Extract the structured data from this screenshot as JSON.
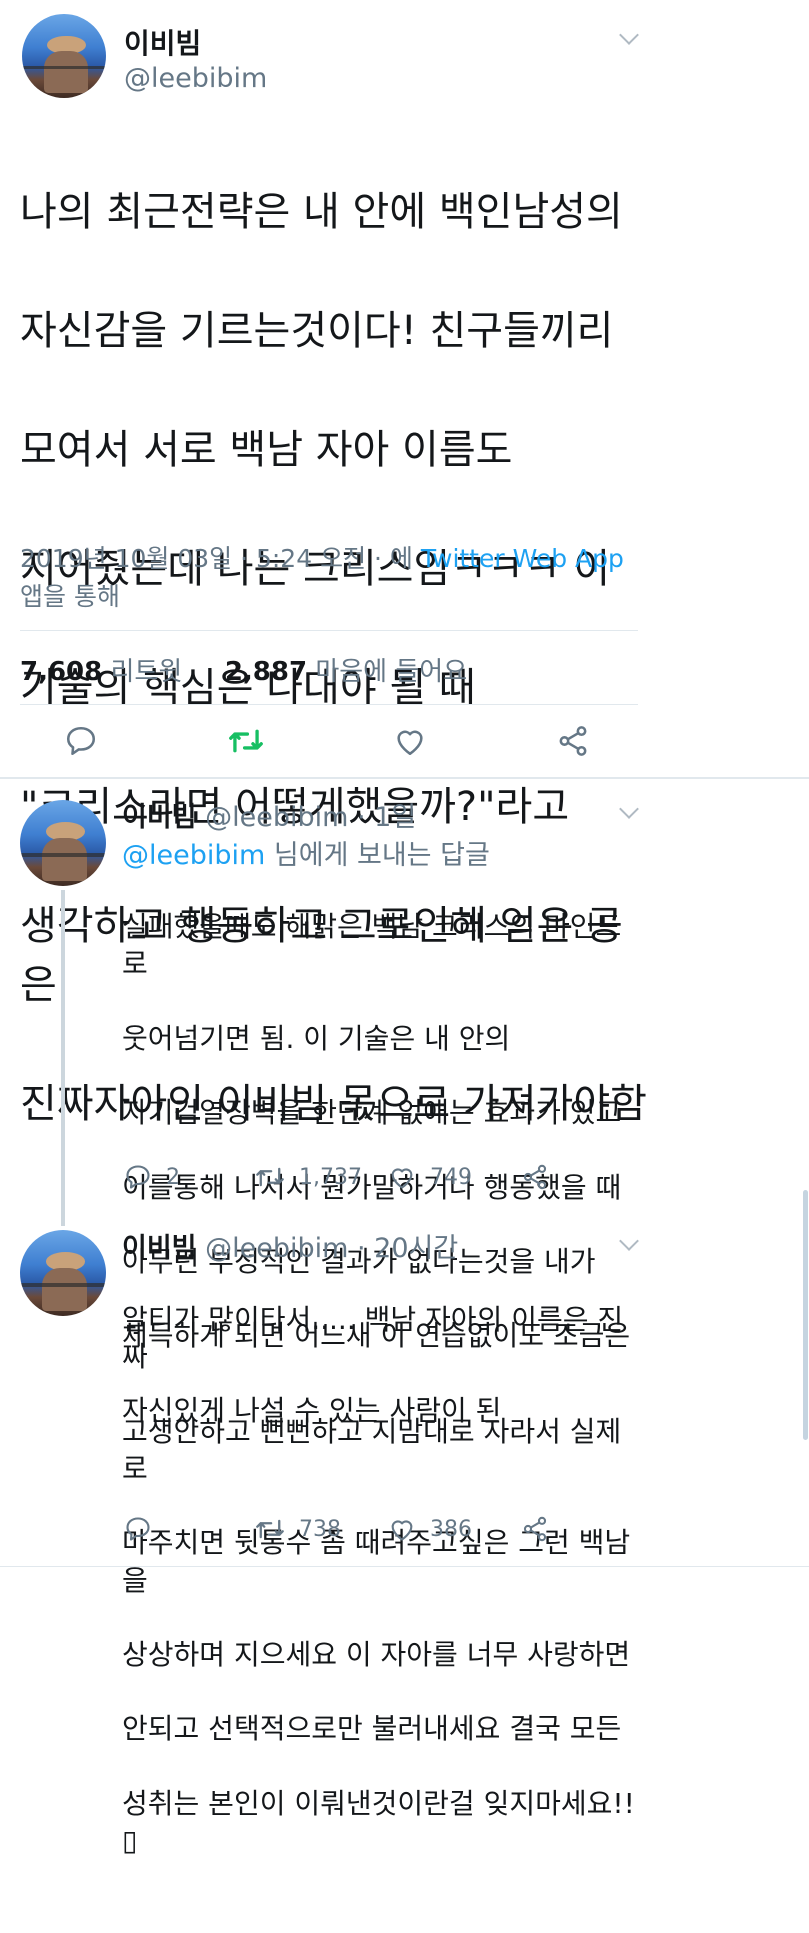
{
  "main_tweet": {
    "display_name": "이비빔",
    "handle": "@leebibim",
    "text_lines": [
      "나의 최근전략은 내 안에 백인남성의",
      "자신감을 기르는것이다! 친구들끼리",
      "모여서 서로 백남 자아 이름도",
      "지어줬는데 나는 크리스임ㅋㅋㅋ 이",
      "기술의 핵심은 나대야 될 때",
      "\"크리스라면 어떻게했을까?\"라고",
      "생각하고 행동하고 그로인해 얻은 공은",
      "진짜자아인 이비빔 몫으로 가져가야함"
    ],
    "timestamp_prefix": "2019년 10월 03일 · 5:24 오전 · 에 ",
    "source_app": "Twitter Web App",
    "timestamp_suffix": "앱을 통해",
    "retweet_count": "7,608",
    "retweet_label": "리트윗",
    "like_count": "2,887",
    "like_label": "마음에 들어요"
  },
  "replies": [
    {
      "display_name": "이비빔",
      "handle_time": "@leebibim · 1일",
      "reply_to_handle": "@leebibim",
      "reply_to_label": " 님에게 보내는 답글",
      "text_lines": [
        "실패했을때도 해맑은 백남 크리스의 마인드로",
        "웃어넘기면 됨. 이 기술은 내 안의",
        "자기검열장벽을 한단계 없애는 효과가 있고",
        "이를통해 나서서 뭔가말하거나 행동했을 때",
        "아무런 부정적인 결과가 없다는것을 내가",
        "체득하게 되면 어느새 이 연습없이도 조금은",
        "자신있게 나설 수 있는 사람이 된"
      ],
      "reply_count": "2",
      "retweet_count": "1,737",
      "like_count": "749"
    },
    {
      "display_name": "이비빔",
      "handle_time": "@leebibim · 20시간",
      "text_lines": [
        "알티가 많이타서..... 백남 자아의 이름은 진짜",
        "고생안하고 뻔뻔하고 지맘대로 자라서 실제로",
        "마주치면 뒷통수 좀 때려주고싶은 그런 백남을",
        "상상하며 지으세요 이 자아를 너무 사랑하면",
        "안되고 선택적으로만 불러내세요 결국 모든",
        "성취는 본인이 이뤄낸것이란걸 잊지마세요!! ▯"
      ],
      "retweet_count": "738",
      "like_count": "386"
    }
  ],
  "icons": [
    "reply-icon",
    "retweet-icon",
    "like-icon",
    "share-icon",
    "chevron-down-icon"
  ],
  "colors": {
    "accent": "#1da1f2",
    "retweet_green": "#17bf63",
    "muted": "#657786",
    "text": "#14171a"
  }
}
